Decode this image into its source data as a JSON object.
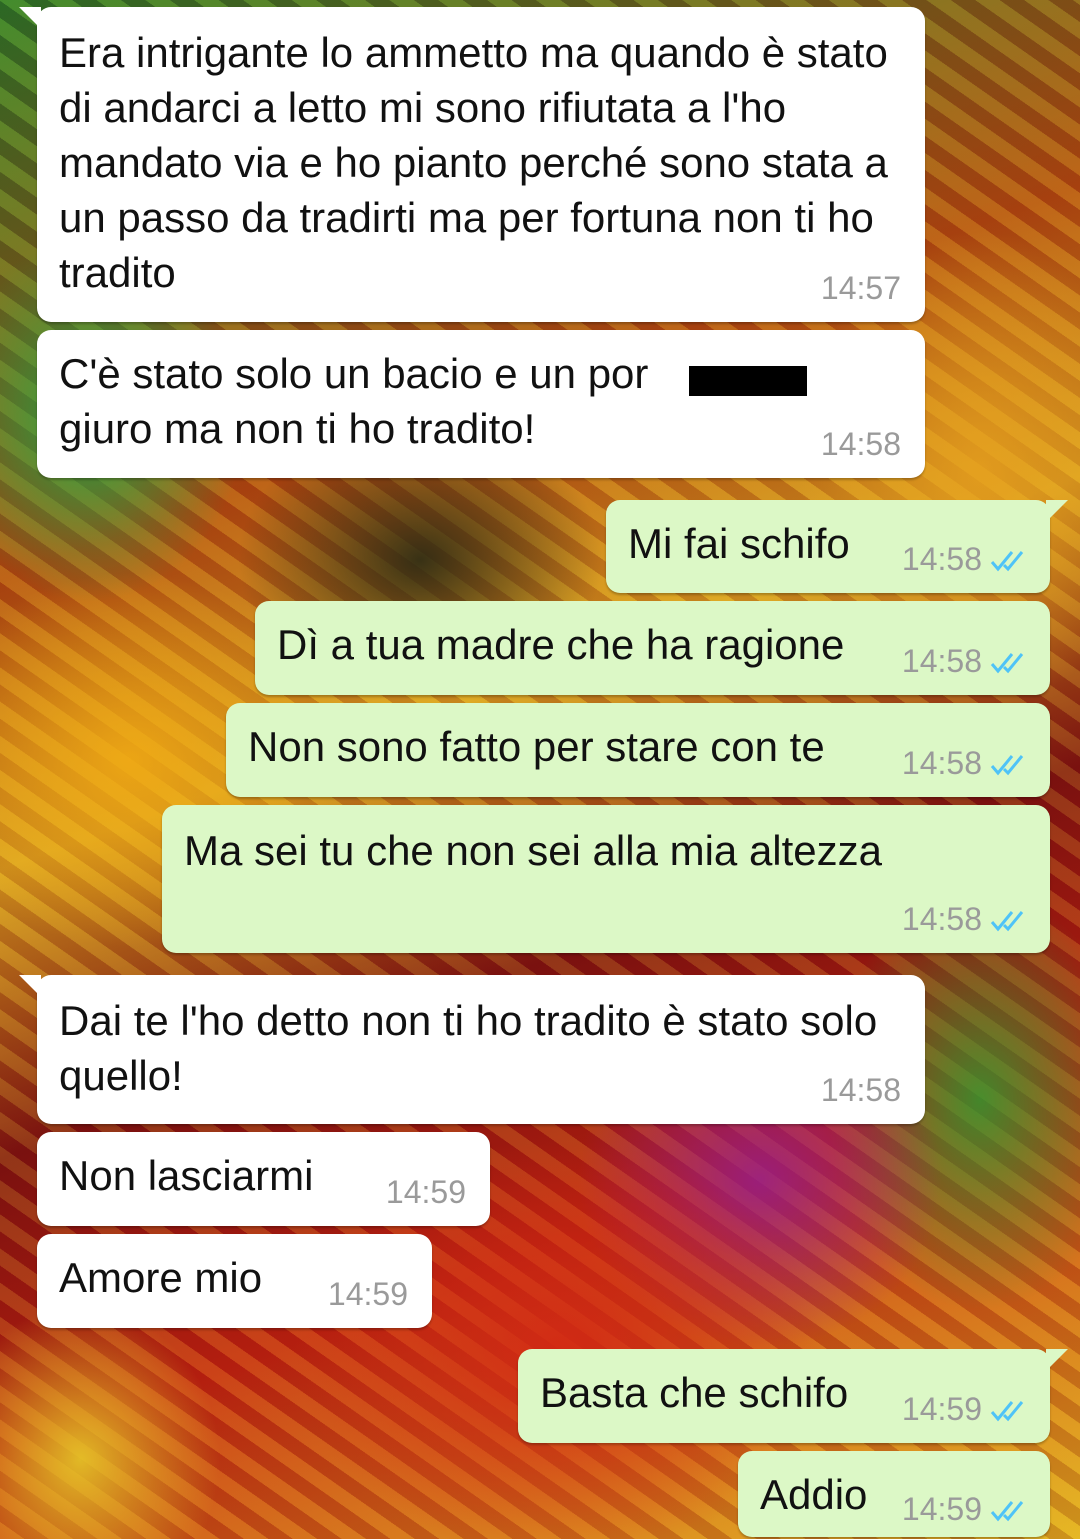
{
  "chat": {
    "messages": [
      {
        "direction": "in",
        "text": "Era intrigante lo ammetto ma quando è stato di andarci a letto mi sono rifiutata a l'ho mandato via e ho pianto perché sono stata a un passo da tradirti ma per fortuna non ti ho tradito",
        "time": "14:57"
      },
      {
        "direction": "in",
        "text": "C'è stato solo un bacio e un por\ngiuro ma non ti ho tradito!",
        "time": "14:58",
        "redacted": true
      },
      {
        "direction": "out",
        "text": "Mi fai schifo",
        "time": "14:58",
        "status": "read"
      },
      {
        "direction": "out",
        "text": "Dì a tua madre che ha ragione",
        "time": "14:58",
        "status": "read"
      },
      {
        "direction": "out",
        "text": "Non sono fatto per stare con te",
        "time": "14:58",
        "status": "read"
      },
      {
        "direction": "out",
        "text": "Ma sei tu che non sei alla mia altezza",
        "time": "14:58",
        "status": "read"
      },
      {
        "direction": "in",
        "text": "Dai te l'ho detto non ti ho tradito è stato solo quello!",
        "time": "14:58"
      },
      {
        "direction": "in",
        "text": "Non lasciarmi",
        "time": "14:59"
      },
      {
        "direction": "in",
        "text": "Amore mio",
        "time": "14:59"
      },
      {
        "direction": "out",
        "text": "Basta che schifo",
        "time": "14:59",
        "status": "read"
      },
      {
        "direction": "out",
        "text": "Addio",
        "time": "14:59",
        "status": "read"
      }
    ]
  },
  "colors": {
    "incoming_bubble": "#ffffff",
    "outgoing_bubble": "#dcf8c6",
    "timestamp": "#9a9a9a",
    "read_ticks": "#4fc3f7"
  },
  "icons": {
    "read_receipt": "double-check-icon"
  }
}
